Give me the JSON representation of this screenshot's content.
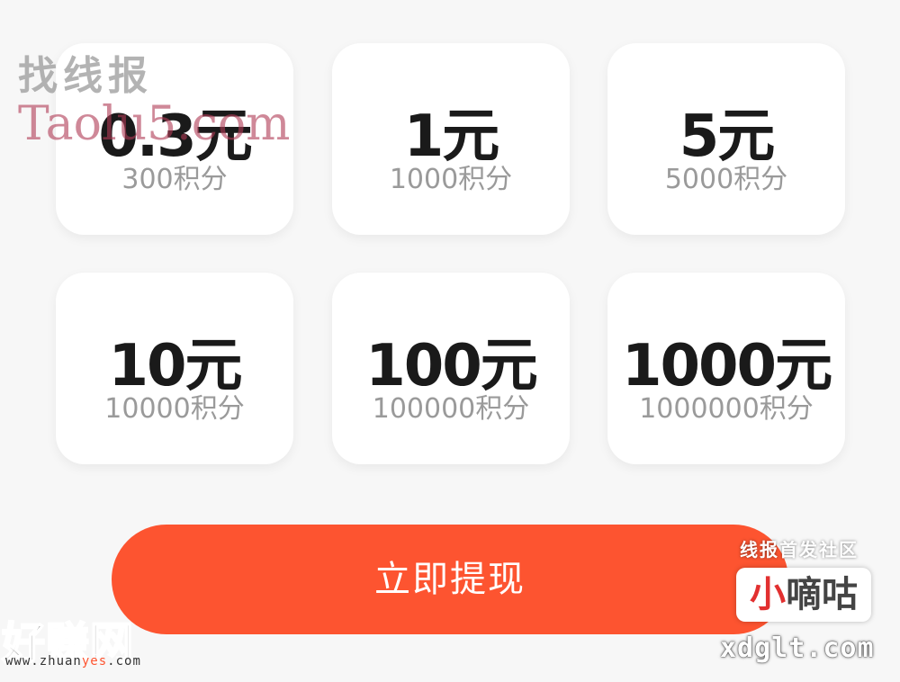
{
  "options": [
    {
      "amount": "0.3元",
      "points": "300积分"
    },
    {
      "amount": "1元",
      "points": "1000积分"
    },
    {
      "amount": "5元",
      "points": "5000积分"
    },
    {
      "amount": "10元",
      "points": "10000积分"
    },
    {
      "amount": "100元",
      "points": "100000积分"
    },
    {
      "amount": "1000元",
      "points": "1000000积分"
    }
  ],
  "withdraw_button": {
    "label": "立即提现",
    "color": "#fd5430"
  },
  "watermarks": {
    "top_left_cn": "找线报",
    "top_left_en": "Taolu5.com",
    "bottom_left_logo": "好赚网",
    "bottom_left_url_a": "www.zhuan",
    "bottom_left_url_b": "yes",
    "bottom_left_url_c": ".com",
    "bottom_right_tag": "线报首发社区",
    "bottom_right_logo_a": "小",
    "bottom_right_logo_b": "嘀咕",
    "bottom_right_domain": "xdglt.com"
  }
}
